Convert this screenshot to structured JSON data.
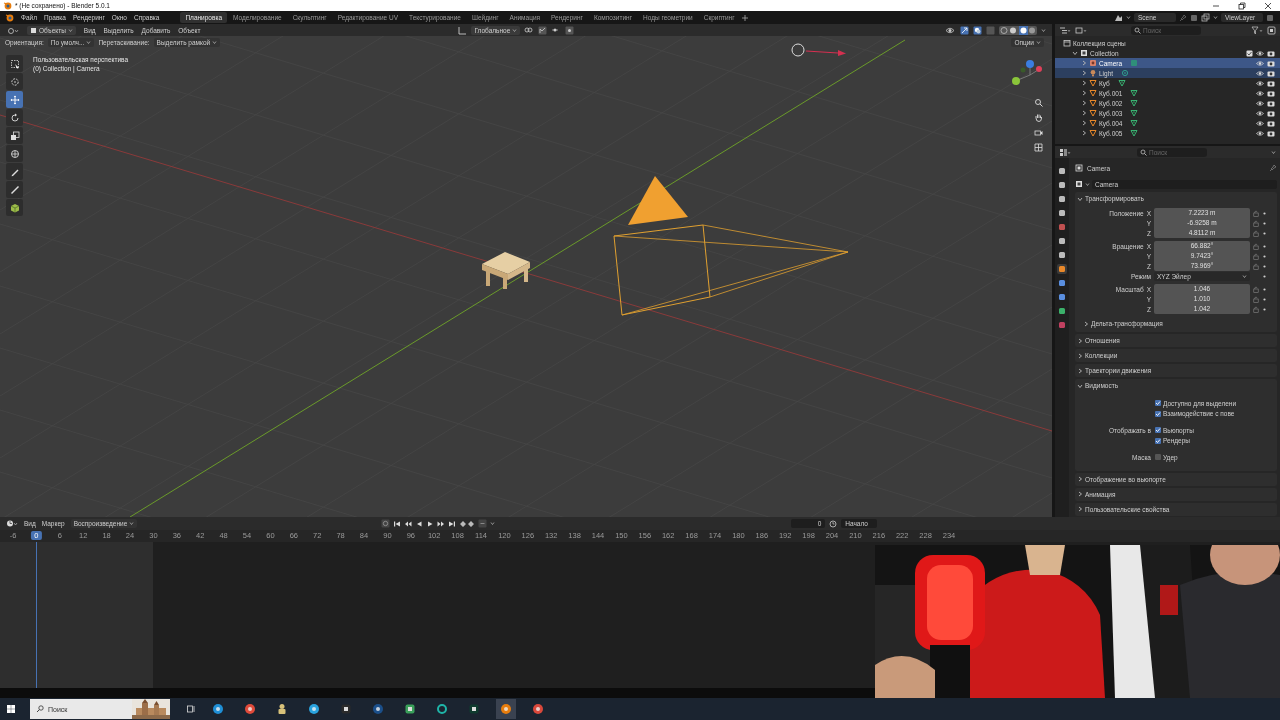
{
  "title_bar": {
    "title": "* (Не сохранено) - Blender 5.0.1"
  },
  "top_bar": {
    "menus": [
      "Файл",
      "Правка",
      "Рендеринг",
      "Окно",
      "Справка"
    ],
    "workspaces": [
      {
        "label": "Планировка",
        "selected": true
      },
      {
        "label": "Моделирование",
        "selected": false
      },
      {
        "label": "Скульптинг",
        "selected": false
      },
      {
        "label": "Редактирование UV",
        "selected": false
      },
      {
        "label": "Текстурирование",
        "selected": false
      },
      {
        "label": "Шейдинг",
        "selected": false
      },
      {
        "label": "Анимация",
        "selected": false
      },
      {
        "label": "Рендеринг",
        "selected": false
      },
      {
        "label": "Композитинг",
        "selected": false
      },
      {
        "label": "Ноды геометрии",
        "selected": false
      },
      {
        "label": "Скриптинг",
        "selected": false
      }
    ],
    "scene": "Scene",
    "view_layer": "ViewLayer"
  },
  "viewport": {
    "mode": "Объекты",
    "menus": [
      "Вид",
      "Выделить",
      "Добавить",
      "Объект"
    ],
    "transform_orientation": "Глобальное",
    "tool_settings": [
      {
        "label": "Ориентация:",
        "value": "По умолч..."
      },
      {
        "label": "Перетаскивание:",
        "value": "Выделить рамкой"
      }
    ],
    "options": "Опции",
    "overlay_text": [
      "Пользовательская перспектива",
      "(0) Collection | Camera"
    ],
    "tools": [
      {
        "kind": "select",
        "selected": false
      },
      {
        "kind": "cursor",
        "selected": false
      },
      {
        "kind": "move",
        "selected": true
      },
      {
        "kind": "rotate",
        "selected": false
      },
      {
        "kind": "scale",
        "selected": false
      },
      {
        "kind": "transform",
        "selected": false
      },
      {
        "kind": "annotate",
        "selected": false
      },
      {
        "kind": "measure",
        "selected": false
      },
      {
        "kind": "add_cube",
        "selected": false
      }
    ]
  },
  "outliner": {
    "search_placeholder": "Поиск",
    "tree": {
      "name": "Коллекция сцены",
      "kind": "scene_collection",
      "children": [
        {
          "name": "Collection",
          "kind": "collection",
          "expanded": true,
          "children": [
            {
              "name": "Camera",
              "kind": "camera",
              "expanded": false,
              "selected": true,
              "active": true
            },
            {
              "name": "Light",
              "kind": "light",
              "expanded": false,
              "selected": true,
              "active": false
            },
            {
              "name": "Куб",
              "kind": "mesh",
              "expanded": false,
              "selected": false,
              "active": false
            },
            {
              "name": "Куб.001",
              "kind": "mesh",
              "expanded": false,
              "selected": false,
              "active": false
            },
            {
              "name": "Куб.002",
              "kind": "mesh",
              "expanded": false,
              "selected": false,
              "active": false
            },
            {
              "name": "Куб.003",
              "kind": "mesh",
              "expanded": false,
              "selected": false,
              "active": false
            },
            {
              "name": "Куб.004",
              "kind": "mesh",
              "expanded": false,
              "selected": false,
              "active": false
            },
            {
              "name": "Куб.005",
              "kind": "mesh",
              "expanded": false,
              "selected": false,
              "active": false
            }
          ]
        }
      ]
    }
  },
  "properties": {
    "search_placeholder": "Поиск",
    "tabs": [
      {
        "selected": false
      },
      {
        "selected": false
      },
      {
        "selected": false
      },
      {
        "selected": false
      },
      {
        "selected": false
      },
      {
        "selected": false
      },
      {
        "selected": false
      },
      {
        "selected": true
      },
      {
        "selected": false
      },
      {
        "selected": false
      },
      {
        "selected": false
      },
      {
        "selected": false
      }
    ],
    "context": "Camera",
    "object_name": "Camera",
    "transform": {
      "title": "Трансформировать",
      "expanded": true,
      "rows": [
        {
          "kind": "vector",
          "label": "Положение",
          "axes": [
            {
              "axis": "X",
              "value": "7.2223 m"
            },
            {
              "axis": "Y",
              "value": "-6.9258 m"
            },
            {
              "axis": "Z",
              "value": "4.8112 m"
            }
          ]
        },
        {
          "kind": "vector",
          "label": "Вращение",
          "axes": [
            {
              "axis": "X",
              "value": "66.882°"
            },
            {
              "axis": "Y",
              "value": "9.7423°"
            },
            {
              "axis": "Z",
              "value": "73.969°"
            }
          ]
        },
        {
          "kind": "dropdown",
          "label": "Режим",
          "value": "XYZ Эйлер"
        },
        {
          "kind": "vector",
          "label": "Масштаб",
          "axes": [
            {
              "axis": "X",
              "value": "1.046"
            },
            {
              "axis": "Y",
              "value": "1.010"
            },
            {
              "axis": "Z",
              "value": "1.042"
            }
          ]
        }
      ],
      "subpanel": {
        "title": "Дельта-трансформация",
        "expanded": false
      }
    },
    "panels": [
      {
        "title": "Отношения",
        "expanded": false
      },
      {
        "title": "Коллекции",
        "expanded": false
      },
      {
        "title": "Траектории движения",
        "expanded": false
      },
      {
        "title": "Видимость",
        "expanded": true,
        "groups": [
          {
            "checks": [
              {
                "label": "Доступно для выделени",
                "checked": true
              },
              {
                "label": "Взаимодействие с пове",
                "checked": true
              }
            ]
          },
          {
            "label": "Отображать в",
            "checks": [
              {
                "label": "Вьюпорты",
                "checked": true
              },
              {
                "label": "Рендеры",
                "checked": true
              }
            ]
          },
          {
            "label": "Маска",
            "checks": [
              {
                "label": "Удер",
                "checked": false
              }
            ]
          }
        ]
      },
      {
        "title": "Отображение во вьюпорте",
        "expanded": false
      },
      {
        "title": "Анимация",
        "expanded": false
      },
      {
        "title": "Пользовательские свойства",
        "expanded": false
      }
    ]
  },
  "timeline": {
    "menus": [
      "Вид",
      "Маркер",
      "Воспроизведение"
    ],
    "frame": "0",
    "start_label": "Начало",
    "frames": [
      {
        "label": "-6",
        "current": false
      },
      {
        "label": "0",
        "current": true
      },
      {
        "label": "6",
        "current": false
      },
      {
        "label": "12",
        "current": false
      },
      {
        "label": "18",
        "current": false
      },
      {
        "label": "24",
        "current": false
      },
      {
        "label": "30",
        "current": false
      },
      {
        "label": "36",
        "current": false
      },
      {
        "label": "42",
        "current": false
      },
      {
        "label": "48",
        "current": false
      },
      {
        "label": "54",
        "current": false
      },
      {
        "label": "60",
        "current": false
      },
      {
        "label": "66",
        "current": false
      },
      {
        "label": "72",
        "current": false
      },
      {
        "label": "78",
        "current": false
      },
      {
        "label": "84",
        "current": false
      },
      {
        "label": "90",
        "current": false
      },
      {
        "label": "96",
        "current": false
      },
      {
        "label": "102",
        "current": false
      },
      {
        "label": "108",
        "current": false
      },
      {
        "label": "114",
        "current": false
      },
      {
        "label": "120",
        "current": false
      },
      {
        "label": "126",
        "current": false
      },
      {
        "label": "132",
        "current": false
      },
      {
        "label": "138",
        "current": false
      },
      {
        "label": "144",
        "current": false
      },
      {
        "label": "150",
        "current": false
      },
      {
        "label": "156",
        "current": false
      },
      {
        "label": "162",
        "current": false
      },
      {
        "label": "168",
        "current": false
      },
      {
        "label": "174",
        "current": false
      },
      {
        "label": "180",
        "current": false
      },
      {
        "label": "186",
        "current": false
      },
      {
        "label": "192",
        "current": false
      },
      {
        "label": "198",
        "current": false
      },
      {
        "label": "204",
        "current": false
      },
      {
        "label": "210",
        "current": false
      },
      {
        "label": "216",
        "current": false
      },
      {
        "label": "222",
        "current": false
      },
      {
        "label": "228",
        "current": false
      },
      {
        "label": "234",
        "current": false
      }
    ]
  },
  "taskbar": {
    "search_placeholder": "Поиск",
    "apps": [
      {
        "kind": "disc",
        "color": "#1f8fd6",
        "selected": false
      },
      {
        "kind": "disc",
        "color": "#e04a3a",
        "selected": false
      },
      {
        "kind": "figure",
        "color": "#d8c27a",
        "selected": false
      },
      {
        "kind": "disc",
        "color": "#2aa3de",
        "selected": false
      },
      {
        "kind": "square",
        "color": "#2b2b2b",
        "selected": false
      },
      {
        "kind": "disc",
        "color": "#1b4f8a",
        "selected": false
      },
      {
        "kind": "square",
        "color": "#3aa05a",
        "selected": false
      },
      {
        "kind": "ring",
        "color": "#1fb5a8",
        "selected": false
      },
      {
        "kind": "square",
        "color": "#0f3b2e",
        "selected": false
      },
      {
        "kind": "disc",
        "color": "#e87d0d",
        "selected": true
      },
      {
        "kind": "disc",
        "color": "#d9483b",
        "selected": false
      }
    ]
  }
}
